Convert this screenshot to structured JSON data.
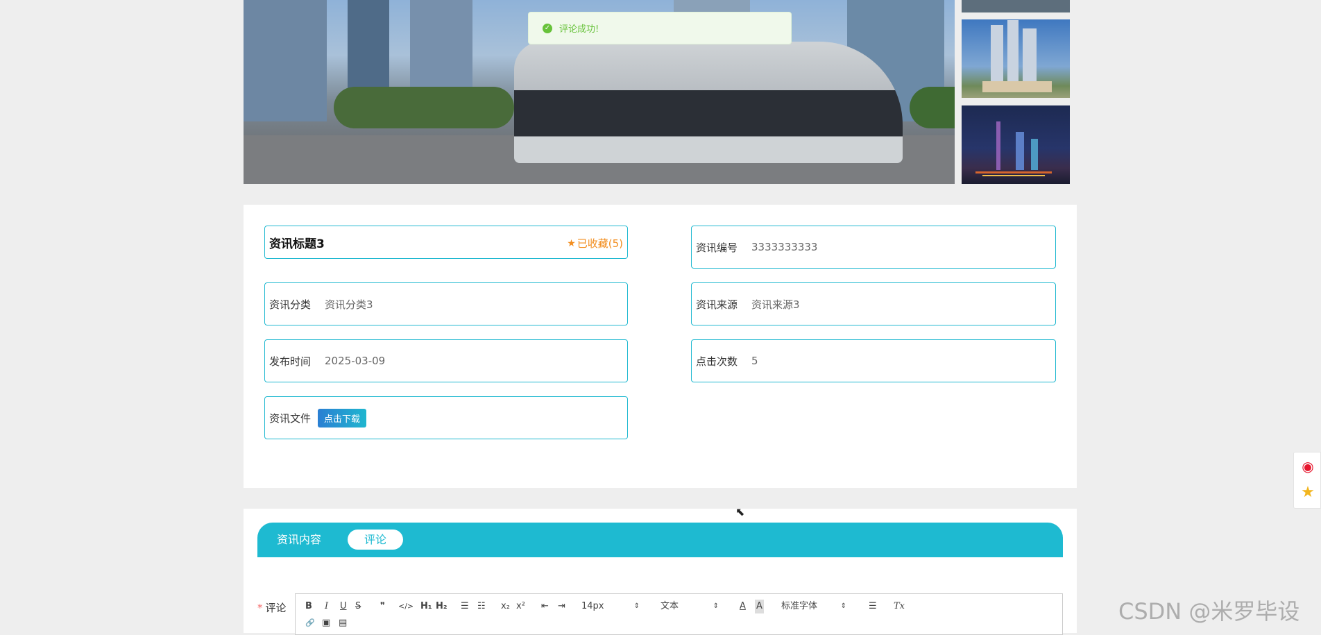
{
  "toast": {
    "message": "评论成功!",
    "icon": "success-check-icon"
  },
  "news": {
    "title": "资讯标题3",
    "favorite_label": "已收藏(5)",
    "fields": {
      "number": {
        "label": "资讯编号",
        "value": "3333333333"
      },
      "category": {
        "label": "资讯分类",
        "value": "资讯分类3"
      },
      "source": {
        "label": "资讯来源",
        "value": "资讯来源3"
      },
      "publish_time": {
        "label": "发布时间",
        "value": "2025-03-09"
      },
      "clicks": {
        "label": "点击次数",
        "value": "5"
      },
      "file": {
        "label": "资讯文件",
        "button": "点击下载"
      }
    }
  },
  "tabs": [
    {
      "label": "资讯内容",
      "active": false
    },
    {
      "label": "评论",
      "active": true
    }
  ],
  "comment": {
    "required_mark": "*",
    "label": "评论",
    "toolbar": {
      "bold": "B",
      "italic": "I",
      "underline": "U",
      "strike": "S",
      "blockquote": "❞",
      "code": "</>",
      "h1": "H₁",
      "h2": "H₂",
      "ordered_list": "☰",
      "bullet_list": "☷",
      "subscript": "x₂",
      "superscript": "x²",
      "outdent": "⇤",
      "indent": "⇥",
      "size": "14px",
      "header": "文本",
      "font": "标准字体",
      "color": "A",
      "background": "A",
      "align": "☰",
      "clean": "Tx",
      "link": "🔗",
      "image": "▣",
      "video": "▤"
    }
  },
  "colors": {
    "accent": "#1ebad1",
    "favorite": "#f28d1e",
    "toast_text": "#67c23a",
    "page_bg": "#eeeeee"
  },
  "watermark": "CSDN @米罗毕设"
}
